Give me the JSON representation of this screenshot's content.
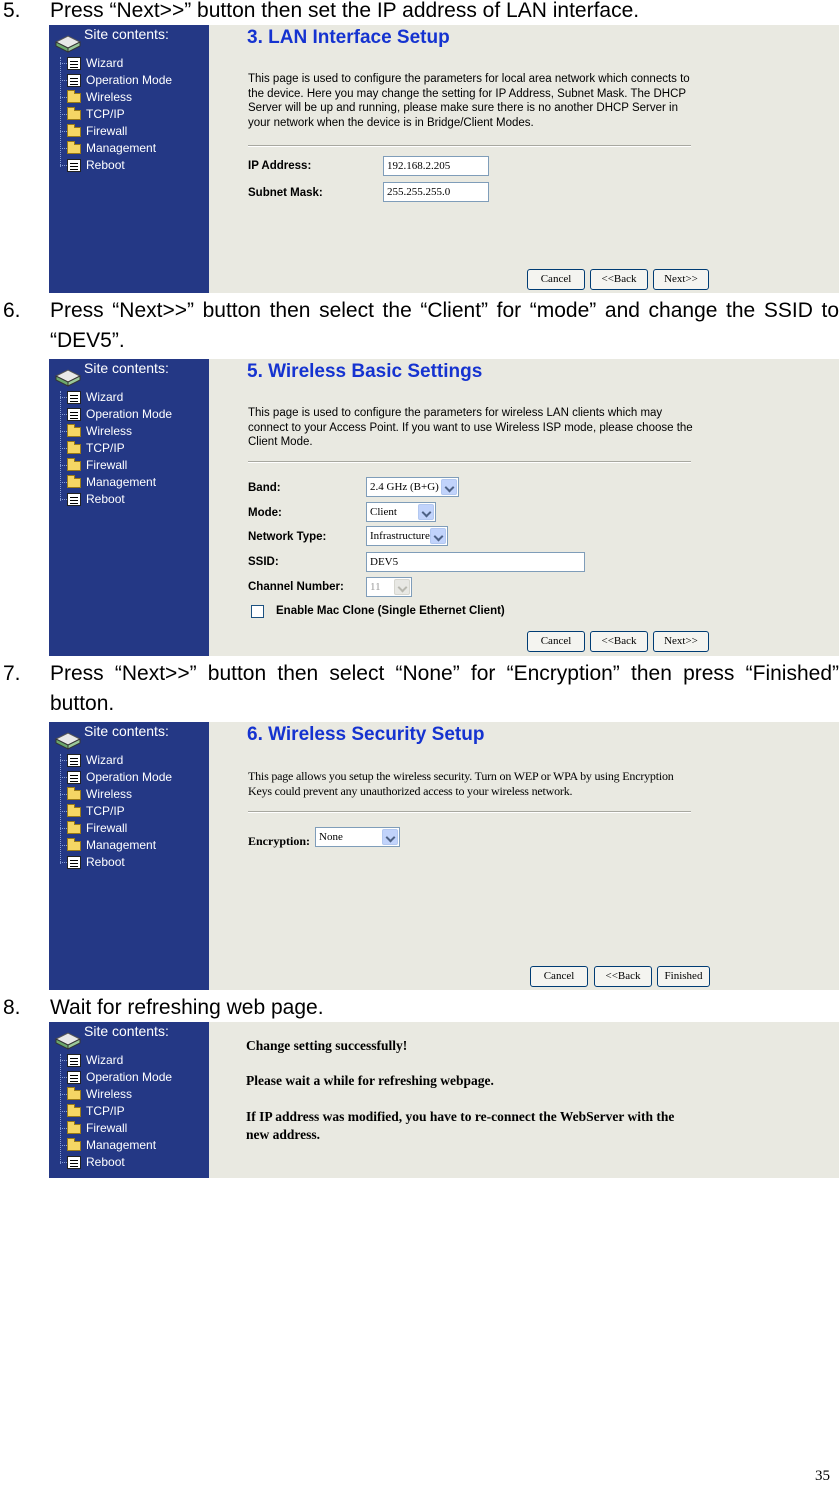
{
  "sidebar": {
    "title": "Site contents:",
    "items": [
      {
        "label": "Wizard",
        "icon": "document-icon"
      },
      {
        "label": "Operation Mode",
        "icon": "document-icon"
      },
      {
        "label": "Wireless",
        "icon": "folder-icon"
      },
      {
        "label": "TCP/IP",
        "icon": "folder-icon"
      },
      {
        "label": "Firewall",
        "icon": "folder-icon"
      },
      {
        "label": "Management",
        "icon": "folder-icon"
      },
      {
        "label": "Reboot",
        "icon": "document-icon"
      }
    ]
  },
  "steps": [
    {
      "number": "5.",
      "text": "Press “Next>>” button then set the IP address of LAN interface."
    },
    {
      "number": "6.",
      "text": "Press “Next>>” button then select the “Client” for “mode” and change the SSID to “DEV5”."
    },
    {
      "number": "7.",
      "text": "Press “Next>>” button then select “None” for “Encryption” then press “Finished” button."
    },
    {
      "number": "8.",
      "text": "Wait for refreshing web page."
    }
  ],
  "lan": {
    "heading": "3. LAN Interface Setup",
    "description": "This page is used to configure the parameters for local area network which connects to the device. Here you may change the setting for IP Address, Subnet Mask. The DHCP Server will be up and running, please make sure there is no another DHCP Server in your network when the device is in Bridge/Client Modes.",
    "ip_label": "IP Address:",
    "ip_value": "192.168.2.205",
    "mask_label": "Subnet Mask:",
    "mask_value": "255.255.255.0"
  },
  "wireless": {
    "heading": "5. Wireless Basic Settings",
    "description": "This page is used to configure the parameters for wireless LAN clients which may connect to your Access Point. If you want to use Wireless ISP mode, please choose the Client Mode.",
    "band_label": "Band:",
    "band_value": "2.4 GHz (B+G)",
    "mode_label": "Mode:",
    "mode_value": "Client",
    "nettype_label": "Network Type:",
    "nettype_value": "Infrastructure",
    "ssid_label": "SSID:",
    "ssid_value": "DEV5",
    "channel_label": "Channel Number:",
    "channel_value": "11",
    "macclone_label": "Enable Mac Clone (Single Ethernet Client)"
  },
  "security": {
    "heading": "6. Wireless Security Setup",
    "description": "This page allows you setup the wireless security. Turn on WEP or WPA by using Encryption Keys could prevent any unauthorized access to your wireless network.",
    "encryption_label": "Encryption:",
    "encryption_value": "None"
  },
  "done": {
    "line1": "Change setting successfully!",
    "line2": "Please wait a while for refreshing webpage.",
    "line3": "If IP address was modified, you have to re-connect the WebServer with the new address."
  },
  "buttons": {
    "cancel": "Cancel",
    "back": "<<Back",
    "next": "Next>>",
    "finished": "Finished"
  },
  "page_number": "35"
}
